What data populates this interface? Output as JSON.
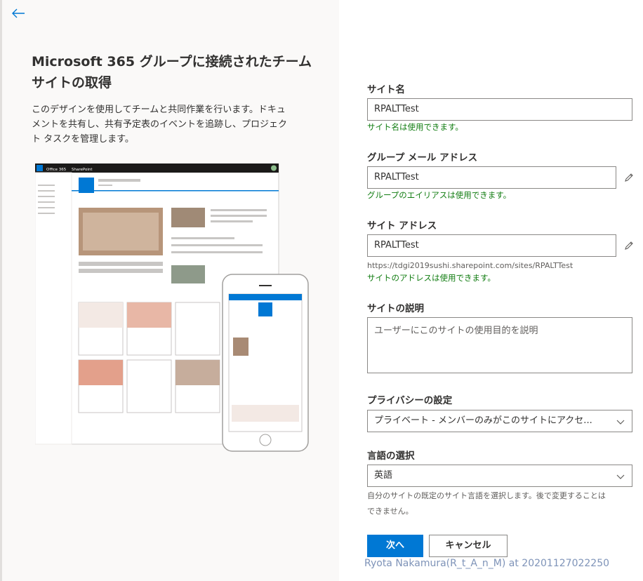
{
  "left": {
    "title_line1": "Microsoft 365 グループに接続されたチーム",
    "title_line2": "サイトの取得",
    "desc_line1": "このデザインを使用してチームと共同作業を行います。ドキュ",
    "desc_line2": "メントを共有し、共有予定表のイベントを追跡し、プロジェク",
    "desc_line3": "ト タスクを管理します。",
    "preview": {
      "office_label": "Office 365",
      "app_label": "SharePoint"
    }
  },
  "form": {
    "site_name": {
      "label": "サイト名",
      "value": "RPALTTest",
      "status": "サイト名は使用できます。"
    },
    "group_email": {
      "label": "グループ メール アドレス",
      "value": "RPALTTest",
      "status": "グループのエイリアスは使用できます。"
    },
    "site_address": {
      "label": "サイト アドレス",
      "value": "RPALTTest",
      "url": "https://tdgi2019sushi.sharepoint.com/sites/RPALTTest",
      "status": "サイトのアドレスは使用できます。"
    },
    "description": {
      "label": "サイトの説明",
      "placeholder": "ユーザーにこのサイトの使用目的を説明"
    },
    "privacy": {
      "label": "プライバシーの設定",
      "value": "プライベート - メンバーのみがこのサイトにアクセ..."
    },
    "language": {
      "label": "言語の選択",
      "value": "英語",
      "help_line1": "自分のサイトの既定のサイト言語を選択します。後で変更することは",
      "help_line2": "できません。"
    }
  },
  "buttons": {
    "next": "次へ",
    "cancel": "キャンセル"
  },
  "watermark": "Ryota Nakamura(R_t_A_n_M) at 20201127022250",
  "colors": {
    "accent": "#0078d4",
    "success": "#107c10"
  }
}
